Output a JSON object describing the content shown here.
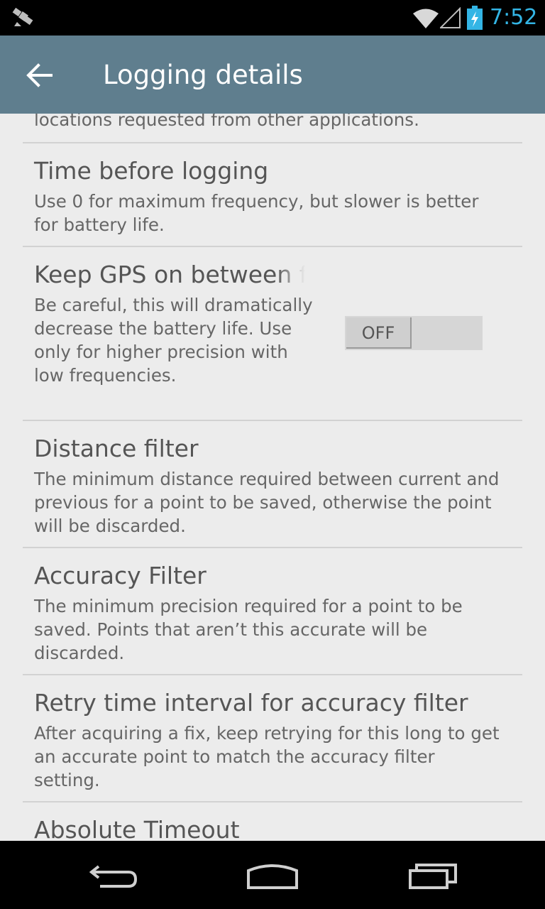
{
  "status_bar": {
    "time": "7:52",
    "icons": [
      "satellite-icon",
      "wifi-icon",
      "signal-icon",
      "battery-charging-icon"
    ],
    "accent_color": "#33b5e5"
  },
  "action_bar": {
    "title": "Logging details",
    "back_icon": "arrow-back-icon",
    "color": "#5f7e8e"
  },
  "settings": {
    "partial_top": {
      "description_tail": "locations requested from other applications."
    },
    "time_before_logging": {
      "title": "Time before logging",
      "description": "Use 0 for maximum frequency, but slower is better for battery life."
    },
    "keep_gps_on": {
      "title": "Keep GPS on between fi",
      "description": "Be careful, this will dramatically decrease the battery life. Use only for higher precision with low frequencies.",
      "toggle_label": "OFF"
    },
    "distance_filter": {
      "title": "Distance filter",
      "description": "The minimum distance required between current and previous for a point to be saved, otherwise the point will be discarded."
    },
    "accuracy_filter": {
      "title": "Accuracy Filter",
      "description": "The minimum precision required for a point to be saved. Points that aren’t this accurate will be discarded."
    },
    "retry_interval": {
      "title": "Retry time interval for accuracy filter",
      "description": "After acquiring a fix, keep retrying for this long to get an accurate point to match the accuracy filter setting."
    },
    "absolute_timeout": {
      "title": "Absolute Timeout"
    }
  },
  "nav_bar": {
    "icons": [
      "back-nav-icon",
      "home-nav-icon",
      "recents-nav-icon"
    ]
  }
}
